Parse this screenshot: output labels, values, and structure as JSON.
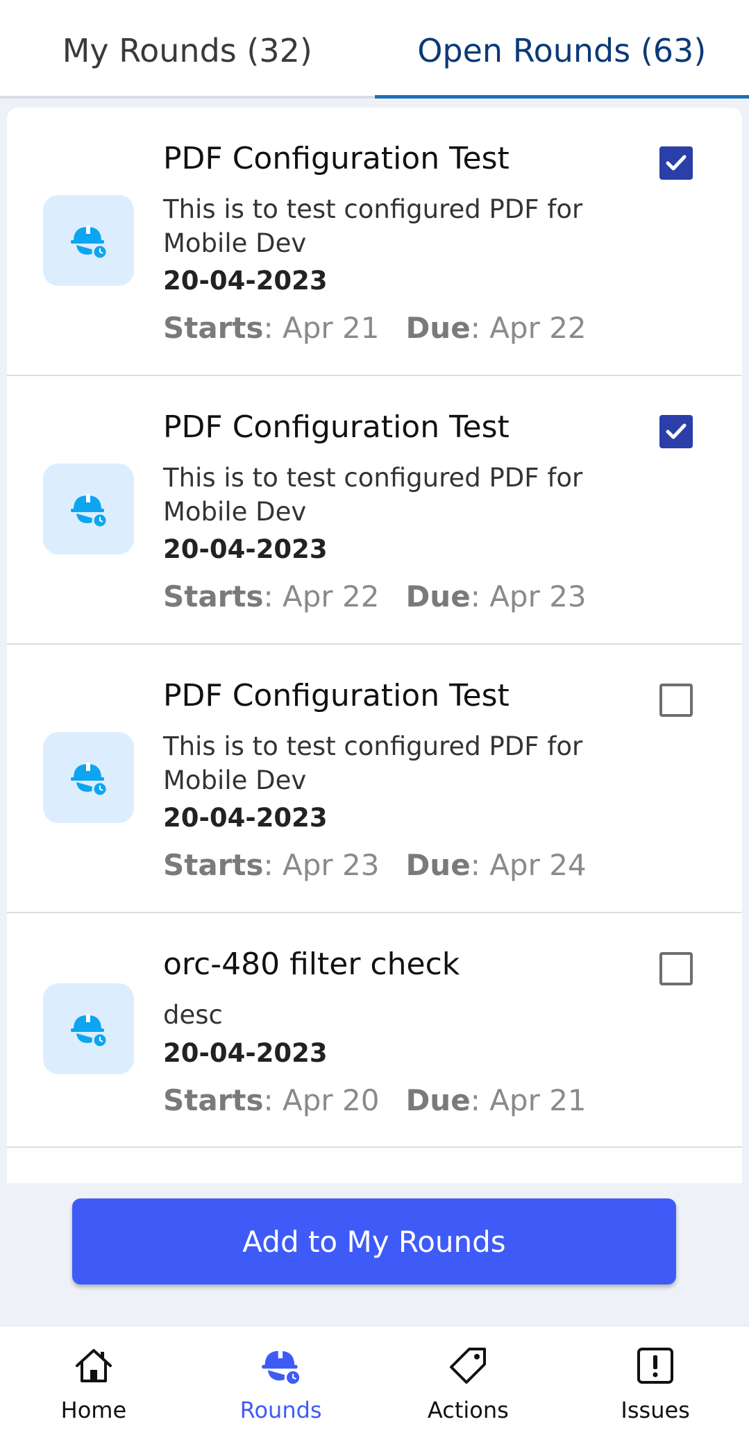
{
  "tabs": {
    "my_rounds": "My Rounds (32)",
    "open_rounds": "Open Rounds (63)",
    "active": "open_rounds"
  },
  "rounds": [
    {
      "title": "PDF Configuration Test",
      "description": "This is to test configured PDF for Mobile Dev",
      "date": "20-04-2023",
      "starts_label": "Starts",
      "starts": ": Apr 21",
      "due_label": "Due",
      "due": ": Apr 22",
      "checked": true,
      "icon": "hardhat-timer-icon"
    },
    {
      "title": "PDF Configuration Test",
      "description": "This is to test configured PDF for Mobile Dev",
      "date": "20-04-2023",
      "starts_label": "Starts",
      "starts": ": Apr 22",
      "due_label": "Due",
      "due": ": Apr 23",
      "checked": true,
      "icon": "hardhat-timer-icon"
    },
    {
      "title": "PDF Configuration Test",
      "description": "This is to test configured PDF for Mobile Dev",
      "date": "20-04-2023",
      "starts_label": "Starts",
      "starts": ": Apr 23",
      "due_label": "Due",
      "due": ": Apr 24",
      "checked": false,
      "icon": "hardhat-timer-icon"
    },
    {
      "title": "orc-480 filter check",
      "description": "desc",
      "date": "20-04-2023",
      "starts_label": "Starts",
      "starts": ": Apr 20",
      "due_label": "Due",
      "due": ": Apr 21",
      "checked": false,
      "icon": "hardhat-timer-icon"
    }
  ],
  "add_button": "Add to My Rounds",
  "bottom_nav": [
    {
      "label": "Home",
      "icon": "home-icon",
      "active": false
    },
    {
      "label": "Rounds",
      "icon": "hardhat-icon",
      "active": true
    },
    {
      "label": "Actions",
      "icon": "tag-icon",
      "active": false
    },
    {
      "label": "Issues",
      "icon": "alert-icon",
      "active": false
    }
  ],
  "colors": {
    "primary": "#3f5bf7",
    "checkbox": "#2b3fa8",
    "icon_blue": "#0ea5f0",
    "icon_bg": "#dceefe",
    "tab_active": "#0b3a78"
  }
}
